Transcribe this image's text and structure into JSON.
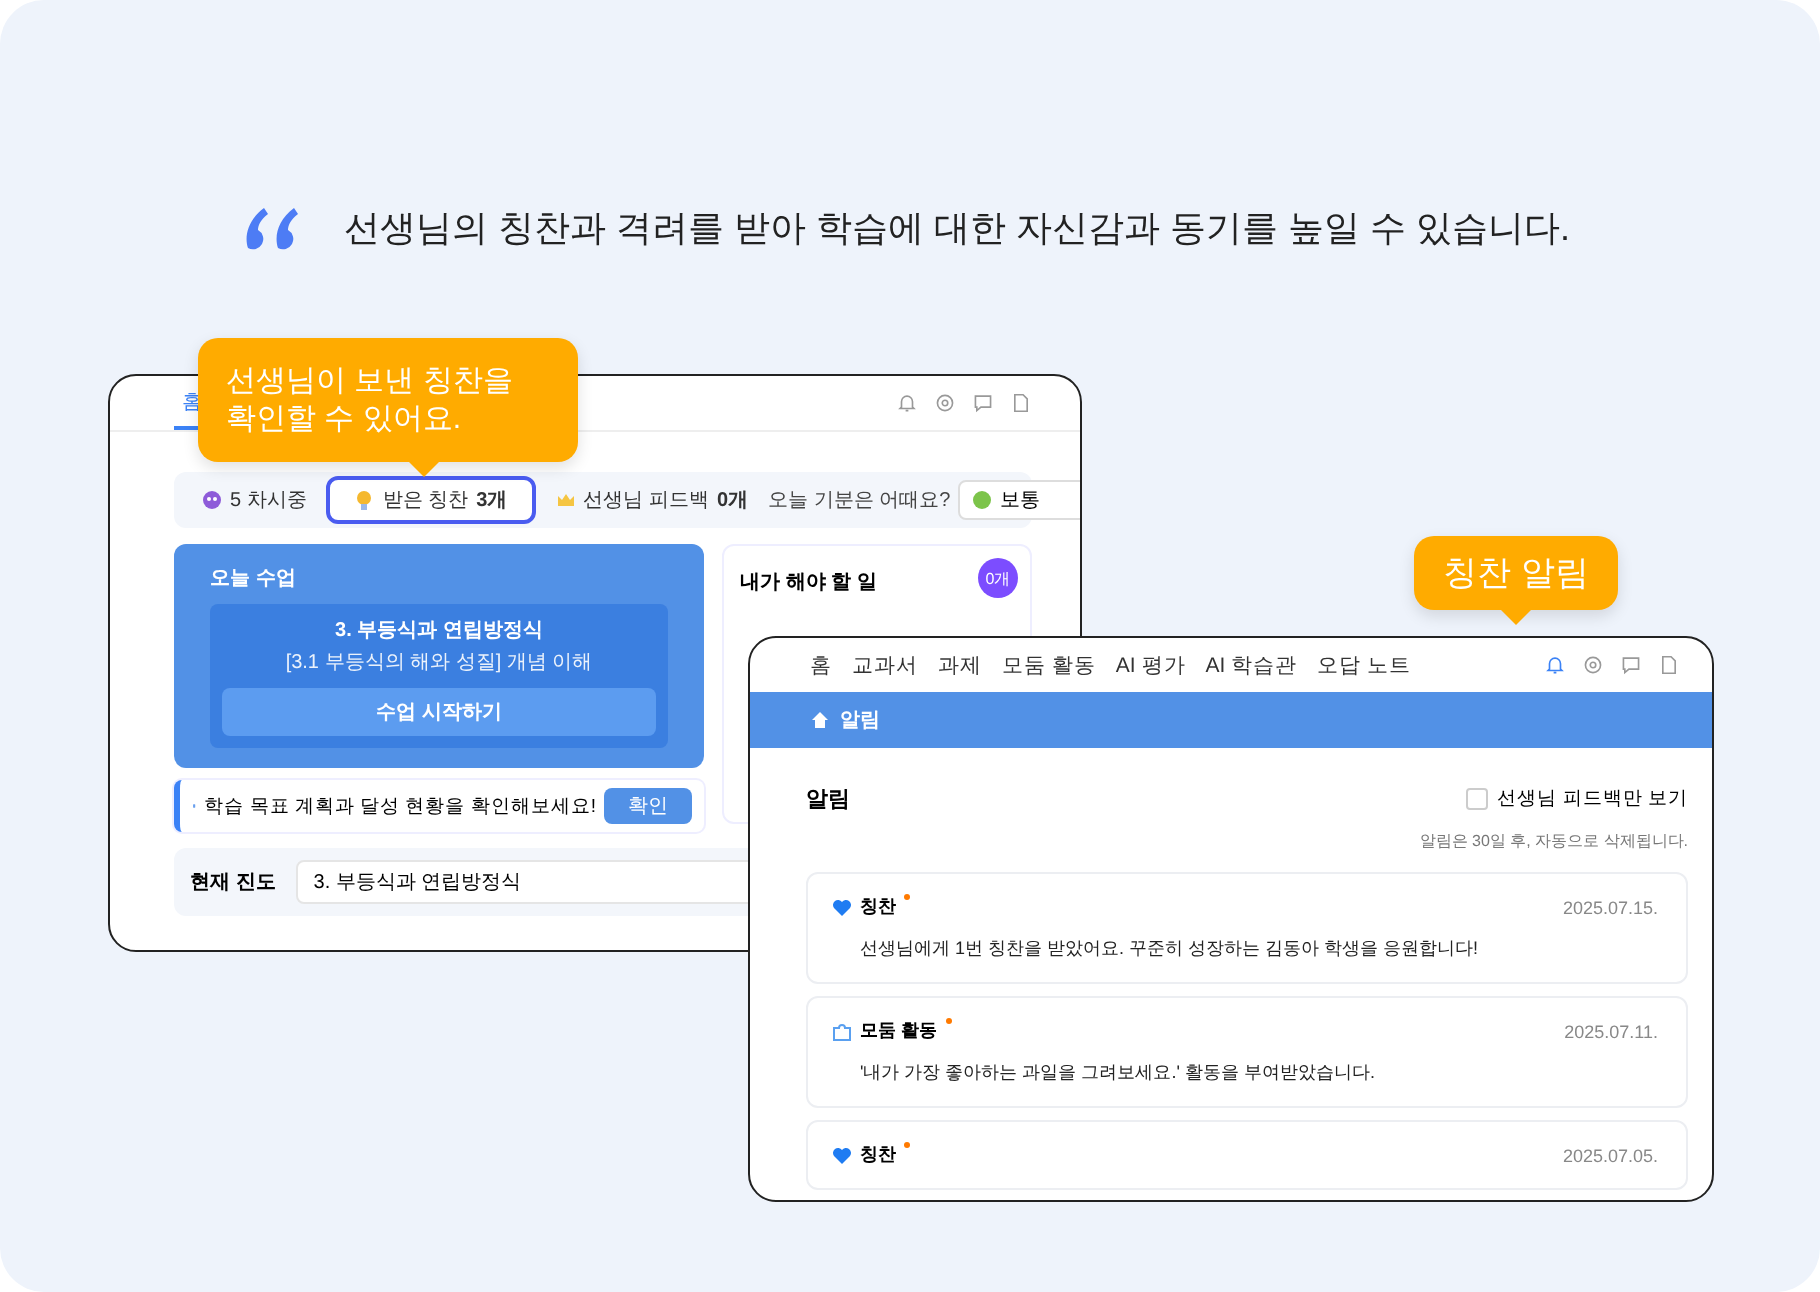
{
  "headline": {
    "text": "선생님의 칭찬과 격려를 받아 학습에 대한 자신감과 동기를 높일 수 있습니다."
  },
  "callouts": [
    {
      "text": "선생님이 보낸 칭찬을 확인할 수 있어요."
    },
    {
      "text": "칭찬 알림"
    }
  ],
  "dashboard": {
    "tabs": [
      {
        "label": "홈",
        "selected": true
      }
    ],
    "header_icons": [
      {
        "kind": "bell",
        "selected": false
      },
      {
        "kind": "gear",
        "selected": false
      },
      {
        "kind": "chat",
        "selected": false
      },
      {
        "kind": "doc",
        "selected": false
      }
    ],
    "stats": [
      {
        "kind": "session",
        "label": "5 차시중",
        "selected": false
      },
      {
        "kind": "praise",
        "label": "받은 칭찬",
        "value": "3개",
        "selected": true
      },
      {
        "kind": "feedback",
        "label": "선생님 피드백",
        "value": "0개",
        "selected": false
      }
    ],
    "mood": {
      "label": "오늘 기분은 어때요?",
      "value": "보통"
    },
    "today_lesson": {
      "title": "오늘 수업",
      "unit": "3. 부등식과 연립방정식",
      "subtitle": "[3.1 부등식의 해와 성질] 개념 이해",
      "button": "수업 시작하기"
    },
    "goal_banner": {
      "text": "학습 목표 계획과 달성 현황을 확인해보세요!",
      "button": "확인"
    },
    "todo": {
      "title": "내가 해야 할 일",
      "badge": "0개"
    },
    "progress": {
      "label": "현재 진도",
      "value": "3. 부등식과 연립방정식"
    }
  },
  "notifications": {
    "nav": [
      {
        "label": "홈",
        "selected": false
      },
      {
        "label": "교과서",
        "selected": false
      },
      {
        "label": "과제",
        "selected": false
      },
      {
        "label": "모둠 활동",
        "selected": false
      },
      {
        "label": "AI 평가",
        "selected": false
      },
      {
        "label": "AI 학습관",
        "selected": false
      },
      {
        "label": "오답 노트",
        "selected": false
      }
    ],
    "header_icons": [
      {
        "kind": "bell",
        "selected": true
      },
      {
        "kind": "gear",
        "selected": false
      },
      {
        "kind": "chat",
        "selected": false
      },
      {
        "kind": "doc",
        "selected": false
      }
    ],
    "breadcrumb": "알림",
    "title": "알림",
    "filter": {
      "label": "선생님 피드백만 보기",
      "checked": false
    },
    "note": "알림은 30일 후, 자동으로 삭제됩니다.",
    "items": [
      {
        "kind": "praise",
        "title": "칭찬",
        "unread": true,
        "date": "2025.07.15.",
        "body": "선생님에게 1번 칭찬을 받았어요. 꾸준히 성장하는 김동아 학생을 응원합니다!"
      },
      {
        "kind": "group",
        "title": "모둠 활동",
        "unread": true,
        "date": "2025.07.11.",
        "body": "'내가 가장 좋아하는 과일을 그려보세요.' 활동을 부여받았습니다."
      },
      {
        "kind": "praise",
        "title": "칭찬",
        "unread": true,
        "date": "2025.07.05."
      }
    ]
  }
}
